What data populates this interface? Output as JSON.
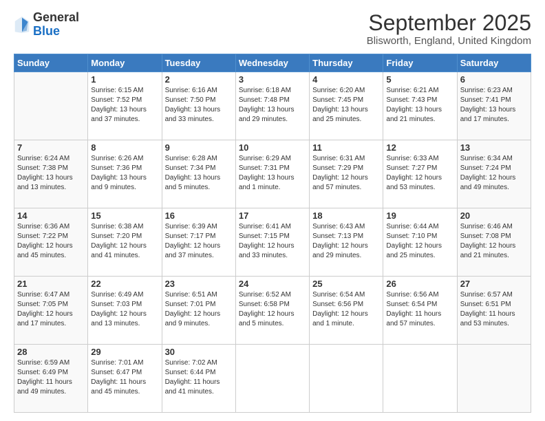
{
  "header": {
    "logo_line1": "General",
    "logo_line2": "Blue",
    "month_title": "September 2025",
    "location": "Blisworth, England, United Kingdom"
  },
  "days_of_week": [
    "Sunday",
    "Monday",
    "Tuesday",
    "Wednesday",
    "Thursday",
    "Friday",
    "Saturday"
  ],
  "weeks": [
    [
      {
        "day": "",
        "info": ""
      },
      {
        "day": "1",
        "info": "Sunrise: 6:15 AM\nSunset: 7:52 PM\nDaylight: 13 hours\nand 37 minutes."
      },
      {
        "day": "2",
        "info": "Sunrise: 6:16 AM\nSunset: 7:50 PM\nDaylight: 13 hours\nand 33 minutes."
      },
      {
        "day": "3",
        "info": "Sunrise: 6:18 AM\nSunset: 7:48 PM\nDaylight: 13 hours\nand 29 minutes."
      },
      {
        "day": "4",
        "info": "Sunrise: 6:20 AM\nSunset: 7:45 PM\nDaylight: 13 hours\nand 25 minutes."
      },
      {
        "day": "5",
        "info": "Sunrise: 6:21 AM\nSunset: 7:43 PM\nDaylight: 13 hours\nand 21 minutes."
      },
      {
        "day": "6",
        "info": "Sunrise: 6:23 AM\nSunset: 7:41 PM\nDaylight: 13 hours\nand 17 minutes."
      }
    ],
    [
      {
        "day": "7",
        "info": "Sunrise: 6:24 AM\nSunset: 7:38 PM\nDaylight: 13 hours\nand 13 minutes."
      },
      {
        "day": "8",
        "info": "Sunrise: 6:26 AM\nSunset: 7:36 PM\nDaylight: 13 hours\nand 9 minutes."
      },
      {
        "day": "9",
        "info": "Sunrise: 6:28 AM\nSunset: 7:34 PM\nDaylight: 13 hours\nand 5 minutes."
      },
      {
        "day": "10",
        "info": "Sunrise: 6:29 AM\nSunset: 7:31 PM\nDaylight: 13 hours\nand 1 minute."
      },
      {
        "day": "11",
        "info": "Sunrise: 6:31 AM\nSunset: 7:29 PM\nDaylight: 12 hours\nand 57 minutes."
      },
      {
        "day": "12",
        "info": "Sunrise: 6:33 AM\nSunset: 7:27 PM\nDaylight: 12 hours\nand 53 minutes."
      },
      {
        "day": "13",
        "info": "Sunrise: 6:34 AM\nSunset: 7:24 PM\nDaylight: 12 hours\nand 49 minutes."
      }
    ],
    [
      {
        "day": "14",
        "info": "Sunrise: 6:36 AM\nSunset: 7:22 PM\nDaylight: 12 hours\nand 45 minutes."
      },
      {
        "day": "15",
        "info": "Sunrise: 6:38 AM\nSunset: 7:20 PM\nDaylight: 12 hours\nand 41 minutes."
      },
      {
        "day": "16",
        "info": "Sunrise: 6:39 AM\nSunset: 7:17 PM\nDaylight: 12 hours\nand 37 minutes."
      },
      {
        "day": "17",
        "info": "Sunrise: 6:41 AM\nSunset: 7:15 PM\nDaylight: 12 hours\nand 33 minutes."
      },
      {
        "day": "18",
        "info": "Sunrise: 6:43 AM\nSunset: 7:13 PM\nDaylight: 12 hours\nand 29 minutes."
      },
      {
        "day": "19",
        "info": "Sunrise: 6:44 AM\nSunset: 7:10 PM\nDaylight: 12 hours\nand 25 minutes."
      },
      {
        "day": "20",
        "info": "Sunrise: 6:46 AM\nSunset: 7:08 PM\nDaylight: 12 hours\nand 21 minutes."
      }
    ],
    [
      {
        "day": "21",
        "info": "Sunrise: 6:47 AM\nSunset: 7:05 PM\nDaylight: 12 hours\nand 17 minutes."
      },
      {
        "day": "22",
        "info": "Sunrise: 6:49 AM\nSunset: 7:03 PM\nDaylight: 12 hours\nand 13 minutes."
      },
      {
        "day": "23",
        "info": "Sunrise: 6:51 AM\nSunset: 7:01 PM\nDaylight: 12 hours\nand 9 minutes."
      },
      {
        "day": "24",
        "info": "Sunrise: 6:52 AM\nSunset: 6:58 PM\nDaylight: 12 hours\nand 5 minutes."
      },
      {
        "day": "25",
        "info": "Sunrise: 6:54 AM\nSunset: 6:56 PM\nDaylight: 12 hours\nand 1 minute."
      },
      {
        "day": "26",
        "info": "Sunrise: 6:56 AM\nSunset: 6:54 PM\nDaylight: 11 hours\nand 57 minutes."
      },
      {
        "day": "27",
        "info": "Sunrise: 6:57 AM\nSunset: 6:51 PM\nDaylight: 11 hours\nand 53 minutes."
      }
    ],
    [
      {
        "day": "28",
        "info": "Sunrise: 6:59 AM\nSunset: 6:49 PM\nDaylight: 11 hours\nand 49 minutes."
      },
      {
        "day": "29",
        "info": "Sunrise: 7:01 AM\nSunset: 6:47 PM\nDaylight: 11 hours\nand 45 minutes."
      },
      {
        "day": "30",
        "info": "Sunrise: 7:02 AM\nSunset: 6:44 PM\nDaylight: 11 hours\nand 41 minutes."
      },
      {
        "day": "",
        "info": ""
      },
      {
        "day": "",
        "info": ""
      },
      {
        "day": "",
        "info": ""
      },
      {
        "day": "",
        "info": ""
      }
    ]
  ]
}
